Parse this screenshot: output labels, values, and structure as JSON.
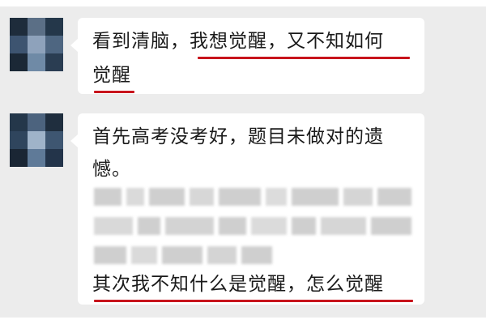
{
  "messages": [
    {
      "lines": [
        "看到清脑，我想觉醒，又不知如何",
        "觉醒"
      ]
    },
    {
      "lines": [
        "首先高考没考好，题目未做对的遗",
        "憾。",
        "其次我不知什么是觉醒，怎么觉醒"
      ]
    }
  ],
  "colors": {
    "background": "#ececec",
    "bubble": "#ffffff",
    "underline": "#c8141c",
    "avatar": "#2c3e52"
  }
}
